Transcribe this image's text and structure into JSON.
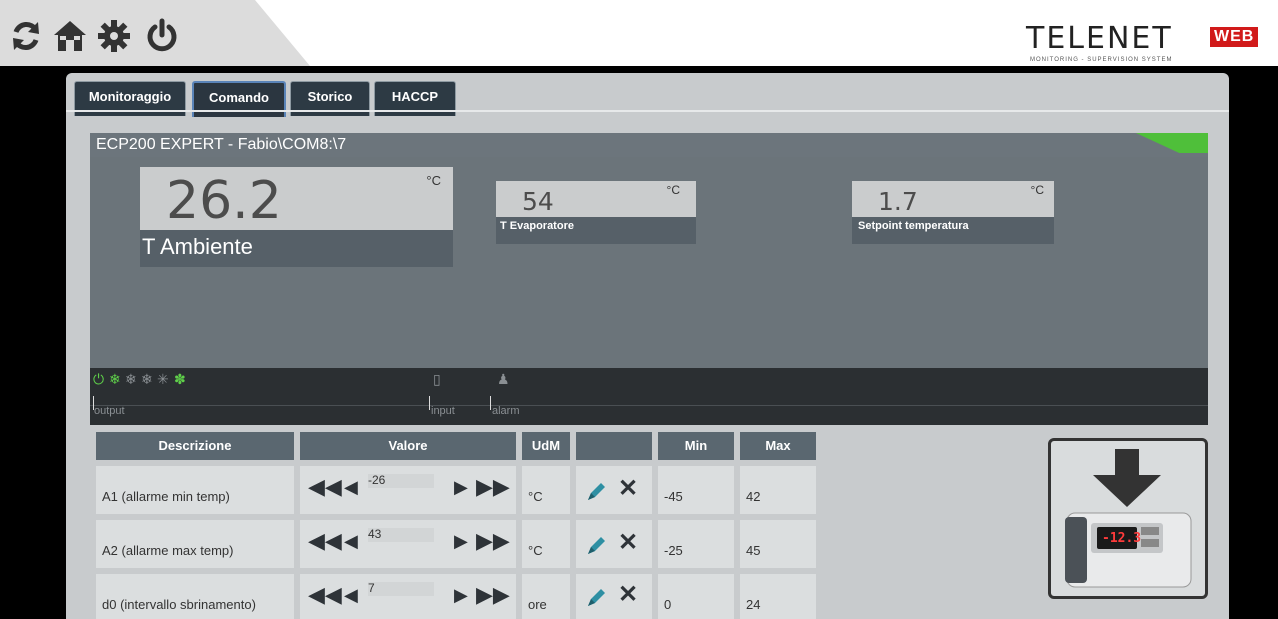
{
  "toolbar": {
    "icons": [
      "refresh-icon",
      "home-icon",
      "gear-icon",
      "power-icon"
    ]
  },
  "brand": {
    "name": "TELENET",
    "badge": "WEB",
    "tagline": "MONITORING - SUPERVISION SYSTEM",
    "badge_color": "#d11a1a"
  },
  "tabs": [
    {
      "label": "Monitoraggio",
      "active": false
    },
    {
      "label": "Comando",
      "active": true
    },
    {
      "label": "Storico",
      "active": false
    },
    {
      "label": "HACCP",
      "active": false
    }
  ],
  "device": {
    "title": "ECP200 EXPERT - Fabio\\COM8:\\7",
    "status_color": "#4fbf3a",
    "gauges": [
      {
        "value": "26.2",
        "unit": "°C",
        "label": "T Ambiente"
      },
      {
        "value": "54",
        "unit": "°C",
        "label": "T Evaporatore"
      },
      {
        "value": "1.7",
        "unit": "°C",
        "label": "Setpoint temperatura"
      }
    ],
    "status_bar": {
      "output_label": "output",
      "input_label": "input",
      "alarm_label": "alarm",
      "output_icons": [
        "power-icon",
        "compressor-icon",
        "defrost-icon",
        "defrost2-icon",
        "light-icon",
        "fan-icon"
      ]
    }
  },
  "table": {
    "headers": {
      "descrizione": "Descrizione",
      "valore": "Valore",
      "udm": "UdM",
      "actions": "",
      "min": "Min",
      "max": "Max"
    },
    "rows": [
      {
        "descrizione": "A1 (allarme min temp)",
        "valore": "-26",
        "udm": "°C",
        "min": "-45",
        "max": "42"
      },
      {
        "descrizione": "A2 (allarme max temp)",
        "valore": "43",
        "udm": "°C",
        "min": "-25",
        "max": "45"
      },
      {
        "descrizione": "d0 (intervallo sbrinamento)",
        "valore": "7",
        "udm": "ore",
        "min": "0",
        "max": "24"
      }
    ]
  },
  "download": {
    "display_value": "-12.3"
  }
}
